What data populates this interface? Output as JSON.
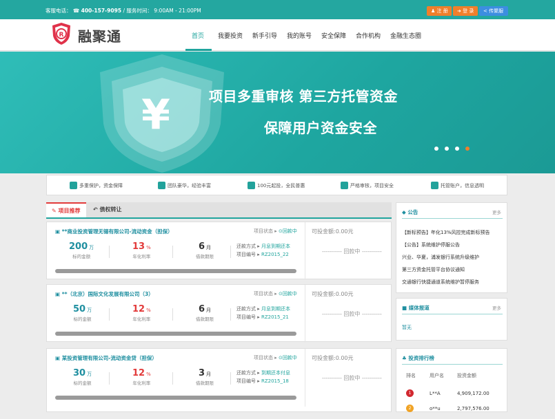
{
  "topbar": {
    "phone_label": "客服电话：",
    "phone": "400-157-9095",
    "hours_label": "/ 服务时间：",
    "hours": "9:00AM - 21:00PM",
    "register": "注 册",
    "login": "登 录",
    "share": "传聚服"
  },
  "header": {
    "logo_text": "融聚通",
    "nav": [
      "首页",
      "我要投资",
      "新手引导",
      "我的账号",
      "安全保障",
      "合作机构",
      "金融生态圈"
    ]
  },
  "banner": {
    "line1": "项目多重审核   第三方托管资金",
    "line2": "保障用户资金安全",
    "slide_count": 4,
    "active_slide": 4
  },
  "features": [
    "多重保护，资金保障",
    "团队豪华，经验丰富",
    "100元起投，全民普惠",
    "严格审核，项目安全",
    "托管账户，信息透明"
  ],
  "tabs": {
    "active": "项目推荐",
    "second": "债权转让"
  },
  "projects": [
    {
      "title": "**商业投资管理无锡有限公司-流动资金（担保）",
      "status_label": "项目状态 ▸",
      "status": "回款中",
      "available_label": "可投金额:",
      "available": "0.00元",
      "amount": "200",
      "amount_unit": "万",
      "amount_label": "标的金额",
      "rate": "13",
      "rate_unit": "%",
      "rate_label": "年化利率",
      "term": "6",
      "term_unit": "月",
      "term_label": "借款期限",
      "repay_label": "还款方式 ▸",
      "repay": "月息到期还本",
      "code_label": "项目编号 ▸",
      "code": "RZ2015_22",
      "repaying": "---------- 回款中 ----------",
      "progress": 1.0
    },
    {
      "title": "**（北京）国际文化发展有限公司（3）",
      "status_label": "项目状态 ▸",
      "status": "回款中",
      "available_label": "可投金额:",
      "available": "0.00元",
      "amount": "50",
      "amount_unit": "万",
      "amount_label": "标的金额",
      "rate": "12",
      "rate_unit": "%",
      "rate_label": "年化利率",
      "term": "6",
      "term_unit": "月",
      "term_label": "借款期限",
      "repay_label": "还款方式 ▸",
      "repay": "月息到期还本",
      "code_label": "项目编号 ▸",
      "code": "RZ2015_21",
      "repaying": "---------- 回款中 ----------",
      "progress": 1.0
    },
    {
      "title": "某投资管理有限公司-流动资金贷（担保）",
      "status_label": "项目状态 ▸",
      "status": "回款中",
      "available_label": "可投金额:",
      "available": "0.00元",
      "amount": "30",
      "amount_unit": "万",
      "amount_label": "标的金额",
      "rate": "12",
      "rate_unit": "%",
      "rate_label": "年化利率",
      "term": "3",
      "term_unit": "月",
      "term_label": "借款期限",
      "repay_label": "还款方式 ▸",
      "repay": "到期还本付息",
      "code_label": "项目编号 ▸",
      "code": "RZ2015_18",
      "repaying": "---------- 回款中 ----------",
      "progress": 1.0
    }
  ],
  "notice": {
    "title": "公告",
    "more": "更多",
    "items": [
      "【新标预告】年化13%风控完成新标预告",
      "【公告】系统维护停服公告",
      "兴业、华夏，浦发银行系统升级维护",
      "第三方资金托管平台协议通知",
      "交通银行快捷通道系统维护暂停服务"
    ]
  },
  "media": {
    "title": "媒体报道",
    "more": "更多",
    "empty": "暂无"
  },
  "ranking": {
    "title": "投资排行榜",
    "headers": [
      "排名",
      "用户名",
      "投资金额"
    ],
    "rows": [
      {
        "rank": "1",
        "user": "L**A",
        "amount": "4,909,172.00"
      },
      {
        "rank": "2",
        "user": "o**u",
        "amount": "2,797,576.00"
      }
    ]
  },
  "colors": {
    "brand": "#24a7a0",
    "accent_orange": "#f07f2b",
    "share_blue": "#3c8ee0",
    "rate_red": "#e23a3a"
  }
}
